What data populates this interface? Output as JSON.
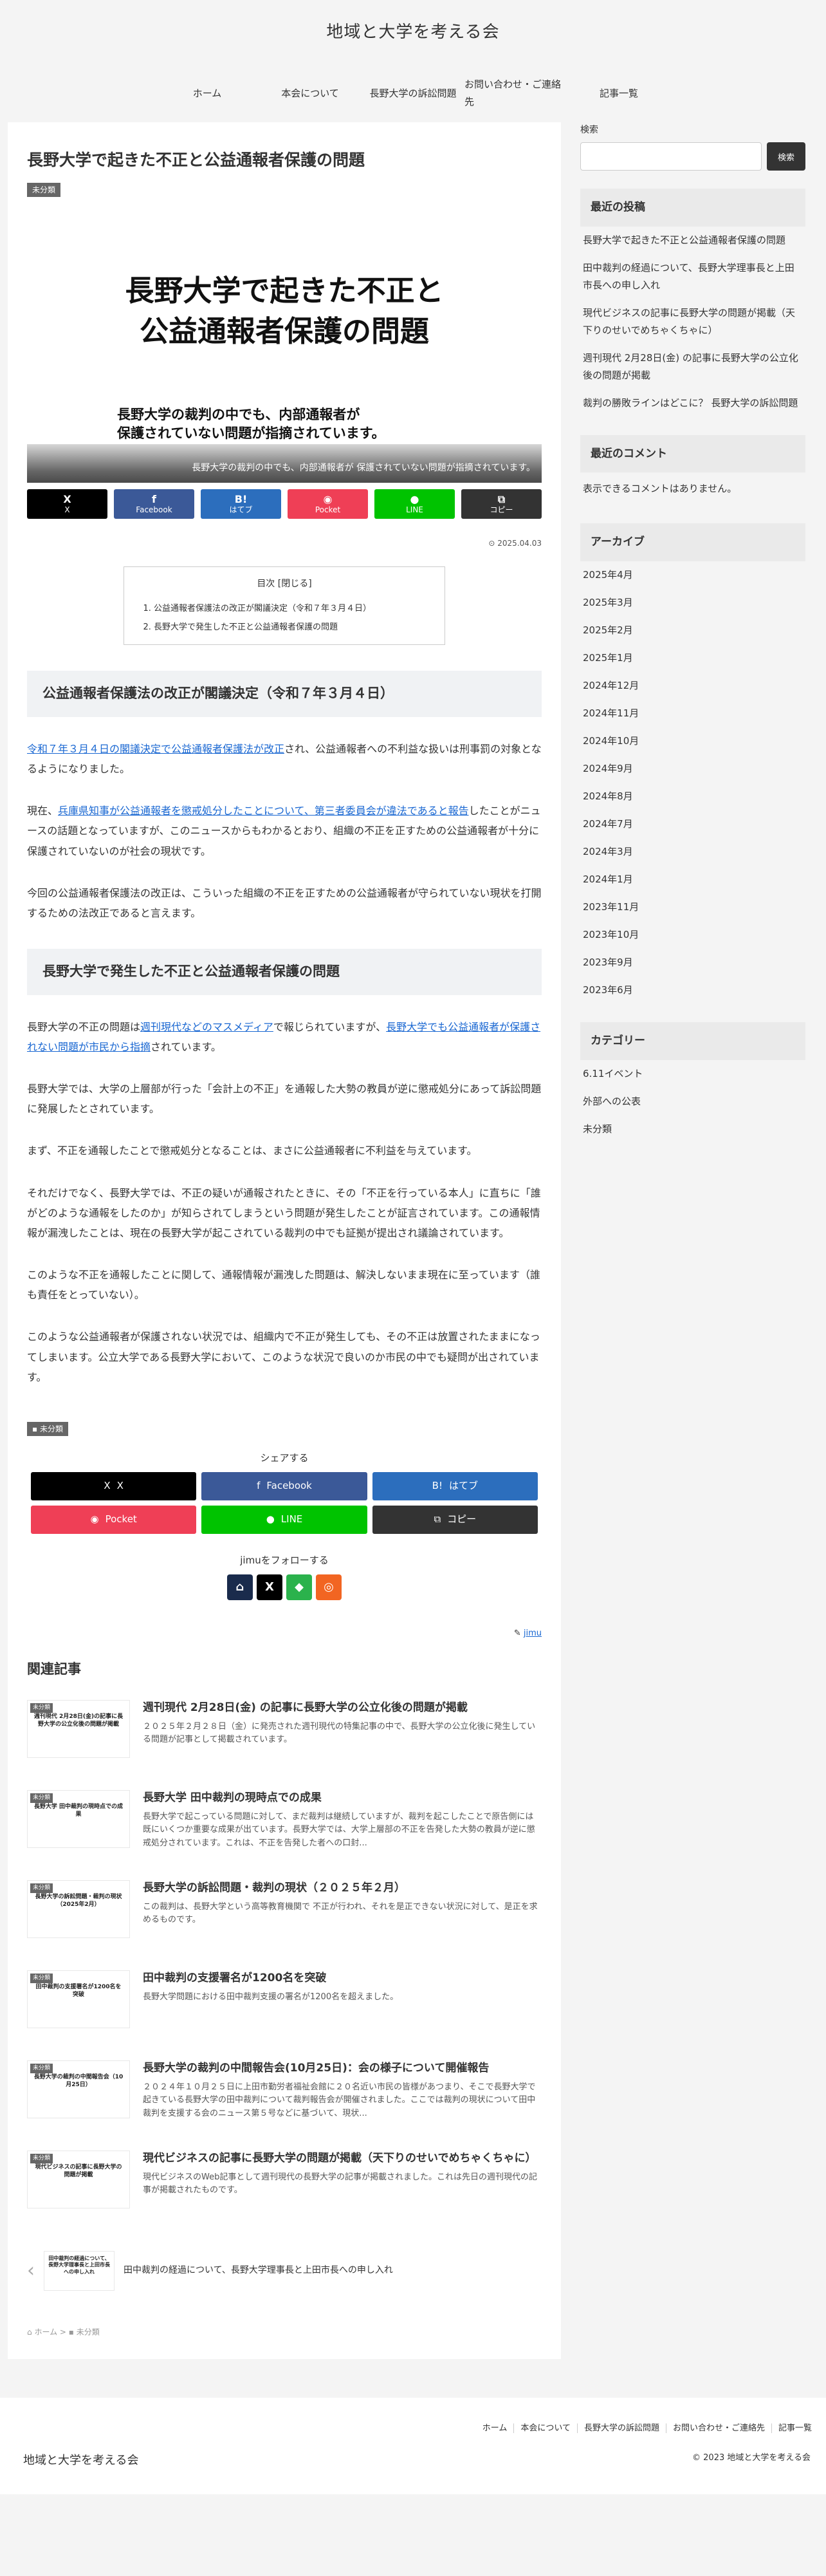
{
  "site": {
    "title": "地域と大学を考える会"
  },
  "nav": [
    "ホーム",
    "本会について",
    "長野大学の訴訟問題",
    "お問い合わせ・ご連絡先",
    "記事一覧"
  ],
  "article": {
    "title": "長野大学で起きた不正と公益通報者保護の問題",
    "category": "未分類",
    "eyecatch": {
      "headline_line1": "長野大学で起きた不正と",
      "headline_line2": "公益通報者保護の問題",
      "sub_line1": "長野大学の裁判の中でも、内部通報者が",
      "sub_line2": "保護されていない問題が指摘されています。",
      "caption": "長野大学の裁判の中でも、内部通報者が 保護されていない問題が指摘されています。"
    },
    "share_top": [
      {
        "icon": "X",
        "label": "X",
        "color": "#000000"
      },
      {
        "icon": "f",
        "label": "Facebook",
        "color": "#3b5998"
      },
      {
        "icon": "B!",
        "label": "はてブ",
        "color": "#2c6ebd"
      },
      {
        "icon": "◉",
        "label": "Pocket",
        "color": "#ef3f56"
      },
      {
        "icon": "●",
        "label": "LINE",
        "color": "#00c300"
      },
      {
        "icon": "⧉",
        "label": "コピー",
        "color": "#333333"
      }
    ],
    "date": "2025.04.03",
    "toc": {
      "title": "目次 [閉じる]",
      "items": [
        "公益通報者保護法の改正が閣議決定（令和７年３月４日）",
        "長野大学で発生した不正と公益通報者保護の問題"
      ]
    },
    "h2_1": "公益通報者保護法の改正が閣議決定（令和７年３月４日）",
    "p1_link": "令和７年３月４日の閣議決定で公益通報者保護法が改正",
    "p1_text": "され、公益通報者への不利益な扱いは刑事罰の対象となるようになりました。",
    "p2_pre": "現在、",
    "p2_link": "兵庫県知事が公益通報者を懲戒処分したことについて、第三者委員会が違法であると報告",
    "p2_post": "したことがニュースの話題となっていますが、このニュースからもわかるとおり、組織の不正を正すための公益通報者が十分に保護されていないのが社会の現状です。",
    "p3": "今回の公益通報者保護法の改正は、こういった組織の不正を正すための公益通報者が守られていない現状を打開するための法改正であると言えます。",
    "h2_2": "長野大学で発生した不正と公益通報者保護の問題",
    "p4_pre": "長野大学の不正の問題は",
    "p4_link1": "週刊現代などのマスメディア",
    "p4_mid": "で報じられていますが、",
    "p4_link2": "長野大学でも公益通報者が保護されない問題が市民から指摘",
    "p4_post": "されています。",
    "p5": "長野大学では、大学の上層部が行った「会計上の不正」を通報した大勢の教員が逆に懲戒処分にあって訴訟問題に発展したとされています。",
    "p6": "まず、不正を通報したことで懲戒処分となることは、まさに公益通報者に不利益を与えています。",
    "p7": "それだけでなく、長野大学では、不正の疑いが通報されたときに、その「不正を行っている本人」に直ちに「誰がどのような通報をしたのか」が知らされてしまうという問題が発生したことが証言されています。この通報情報が漏洩したことは、現在の長野大学が起こされている裁判の中でも証拠が提出され議論されています。",
    "p8": "このような不正を通報したことに関して、通報情報が漏洩した問題は、解決しないまま現在に至っています（誰も責任をとっていない）。",
    "p9": "このような公益通報者が保護されない状況では、組織内で不正が発生しても、その不正は放置されたままになってしまいます。公立大学である長野大学において、このような状況で良いのか市民の中でも疑問が出されています。",
    "tag": "未分類",
    "share_title": "シェアする",
    "share_bottom": [
      {
        "icon": "X",
        "label": "X",
        "color": "#000000"
      },
      {
        "icon": "f",
        "label": "Facebook",
        "color": "#3b5998"
      },
      {
        "icon": "B!",
        "label": "はてブ",
        "color": "#2c6ebd"
      },
      {
        "icon": "◉",
        "label": "Pocket",
        "color": "#ef3f56"
      },
      {
        "icon": "●",
        "label": "LINE",
        "color": "#00c300"
      },
      {
        "icon": "⧉",
        "label": "コピー",
        "color": "#333333"
      }
    ],
    "follow_title": "jimuをフォローする",
    "follow": [
      {
        "icon": "⌂",
        "name": "home-icon",
        "color": "#1a2b4c"
      },
      {
        "icon": "X",
        "name": "x-icon",
        "color": "#000000"
      },
      {
        "icon": "◆",
        "name": "feedly-icon",
        "color": "#2bb24c"
      },
      {
        "icon": "◎",
        "name": "rss-icon",
        "color": "#f26522"
      }
    ],
    "author": "jimu"
  },
  "related": {
    "title": "関連記事",
    "items": [
      {
        "badge": "未分類",
        "thumb": "週刊現代 2月28日(金)の記事に長野大学の公立化後の問題が掲載",
        "title": "週刊現代 2月28日(金) の記事に長野大学の公立化後の問題が掲載",
        "snippet": "２０２５年２月２８日（金）に発売された週刊現代の特集記事の中で、長野大学の公立化後に発生している問題が記事として掲載されています。"
      },
      {
        "badge": "未分類",
        "thumb": "長野大学 田中裁判の現時点での成果",
        "title": "長野大学 田中裁判の現時点での成果",
        "snippet": "長野大学で起こっている問題に対して、まだ裁判は継続していますが、裁判を起こしたことで原告側には既にいくつか重要な成果が出ています。長野大学では、大学上層部の不正を告発した大勢の教員が逆に懲戒処分されています。これは、不正を告発した者への口封..."
      },
      {
        "badge": "未分類",
        "thumb": "長野大学の訴訟問題・裁判の現状（2025年2月）",
        "title": "長野大学の訴訟問題・裁判の現状（２０２５年２月）",
        "snippet": "この裁判は、長野大学という高等教育機関で 不正が行われ、それを是正できない状況に対して、是正を求めるものです。"
      },
      {
        "badge": "未分類",
        "thumb": "田中裁判の支援署名が1200名を突破",
        "title": "田中裁判の支援署名が1200名を突破",
        "snippet": "長野大学問題における田中裁判支援の署名が1200名を超えました。"
      },
      {
        "badge": "未分類",
        "thumb": "長野大学の裁判の中間報告会（10月25日）",
        "title": "長野大学の裁判の中間報告会(10月25日)：会の様子について開催報告",
        "snippet": "２０２４年１０月２５日に上田市勤労者福祉会館に２０名近い市民の皆様があつまり、そこで長野大学で起きている長野大学の田中裁判について裁判報告会が開催されました。ここでは裁判の現状について田中裁判を支援する会のニュース第５号などに基づいて、現状..."
      },
      {
        "badge": "未分類",
        "thumb": "現代ビジネスの記事に長野大学の問題が掲載",
        "title": "現代ビジネスの記事に長野大学の問題が掲載（天下りのせいでめちゃくちゃに）",
        "snippet": "現代ビジネスのWeb記事として週刊現代の長野大学の記事が掲載されました。これは先日の週刊現代の記事が掲載されたものです。"
      }
    ]
  },
  "prev": {
    "thumb": "田中裁判の経過について、長野大学理事長と上田市長への申し入れ",
    "title": "田中裁判の経過について、長野大学理事長と上田市長への申し入れ"
  },
  "breadcrumb": {
    "home": "ホーム",
    "sep": ">",
    "category": "未分類"
  },
  "sidebar": {
    "search_label": "検索",
    "search_placeholder": "",
    "search_button": "検索",
    "recent_title": "最近の投稿",
    "recent": [
      "長野大学で起きた不正と公益通報者保護の問題",
      "田中裁判の経過について、長野大学理事長と上田市長への申し入れ",
      "現代ビジネスの記事に長野大学の問題が掲載（天下りのせいでめちゃくちゃに）",
      "週刊現代 2月28日(金) の記事に長野大学の公立化後の問題が掲載",
      "裁判の勝敗ラインはどこに？ 長野大学の訴訟問題"
    ],
    "comments_title": "最近のコメント",
    "comments_text": "表示できるコメントはありません。",
    "archive_title": "アーカイブ",
    "archives": [
      "2025年4月",
      "2025年3月",
      "2025年2月",
      "2025年1月",
      "2024年12月",
      "2024年11月",
      "2024年10月",
      "2024年9月",
      "2024年8月",
      "2024年7月",
      "2024年3月",
      "2024年1月",
      "2023年11月",
      "2023年10月",
      "2023年9月",
      "2023年6月"
    ],
    "category_title": "カテゴリー",
    "categories": [
      "6.11イベント",
      "外部への公表",
      "未分類"
    ]
  },
  "footer": {
    "nav": [
      "ホーム",
      "本会について",
      "長野大学の訴訟問題",
      "お問い合わせ・ご連絡先",
      "記事一覧"
    ],
    "site": "地域と大学を考える会",
    "copyright": "© 2023 地域と大学を考える会"
  }
}
